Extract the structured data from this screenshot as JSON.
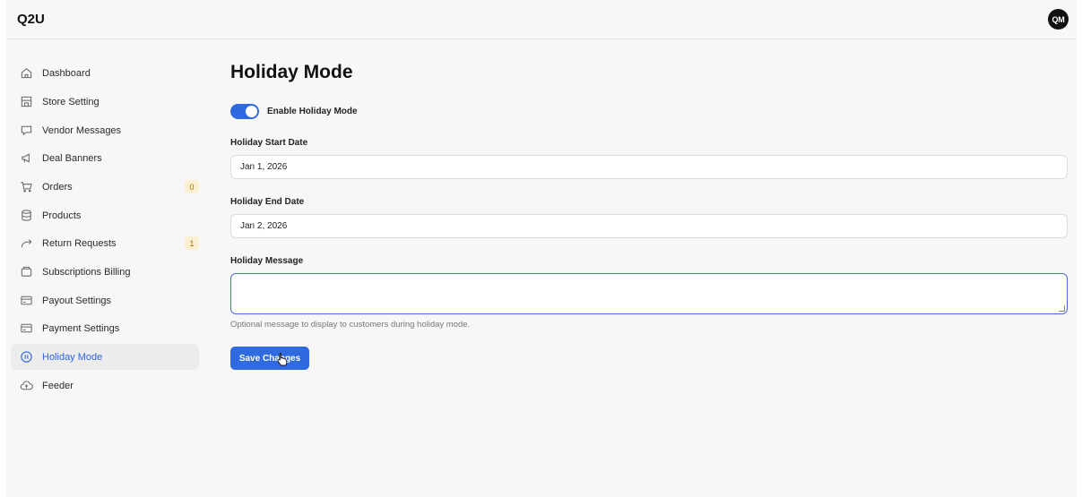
{
  "app": {
    "brand": "Q2U",
    "avatar_initials": "QM"
  },
  "sidebar": {
    "items": [
      {
        "label": "Dashboard",
        "icon": "home-icon"
      },
      {
        "label": "Store Setting",
        "icon": "store-icon"
      },
      {
        "label": "Vendor Messages",
        "icon": "chat-icon"
      },
      {
        "label": "Deal Banners",
        "icon": "megaphone-icon"
      },
      {
        "label": "Orders",
        "icon": "cart-icon",
        "badge": "0"
      },
      {
        "label": "Products",
        "icon": "database-icon"
      },
      {
        "label": "Return Requests",
        "icon": "return-arrow-icon",
        "badge": "1"
      },
      {
        "label": "Subscriptions Billing",
        "icon": "wallet-icon"
      },
      {
        "label": "Payout Settings",
        "icon": "card-icon"
      },
      {
        "label": "Payment Settings",
        "icon": "card-icon"
      },
      {
        "label": "Holiday Mode",
        "icon": "pause-circle-icon",
        "active": true
      },
      {
        "label": "Feeder",
        "icon": "cloud-upload-icon"
      }
    ]
  },
  "main": {
    "title": "Holiday Mode",
    "toggle": {
      "label": "Enable Holiday Mode",
      "enabled": true
    },
    "start_date": {
      "label": "Holiday Start Date",
      "value": "Jan 1, 2026"
    },
    "end_date": {
      "label": "Holiday End Date",
      "value": "Jan 2, 2026"
    },
    "message": {
      "label": "Holiday Message",
      "value": "",
      "hint": "Optional message to display to customers during holiday mode."
    },
    "save_label": "Save Changes"
  },
  "colors": {
    "accent": "#2f6ae0",
    "badge_bg": "#fbf1d2",
    "active_text": "#2f63d6"
  }
}
